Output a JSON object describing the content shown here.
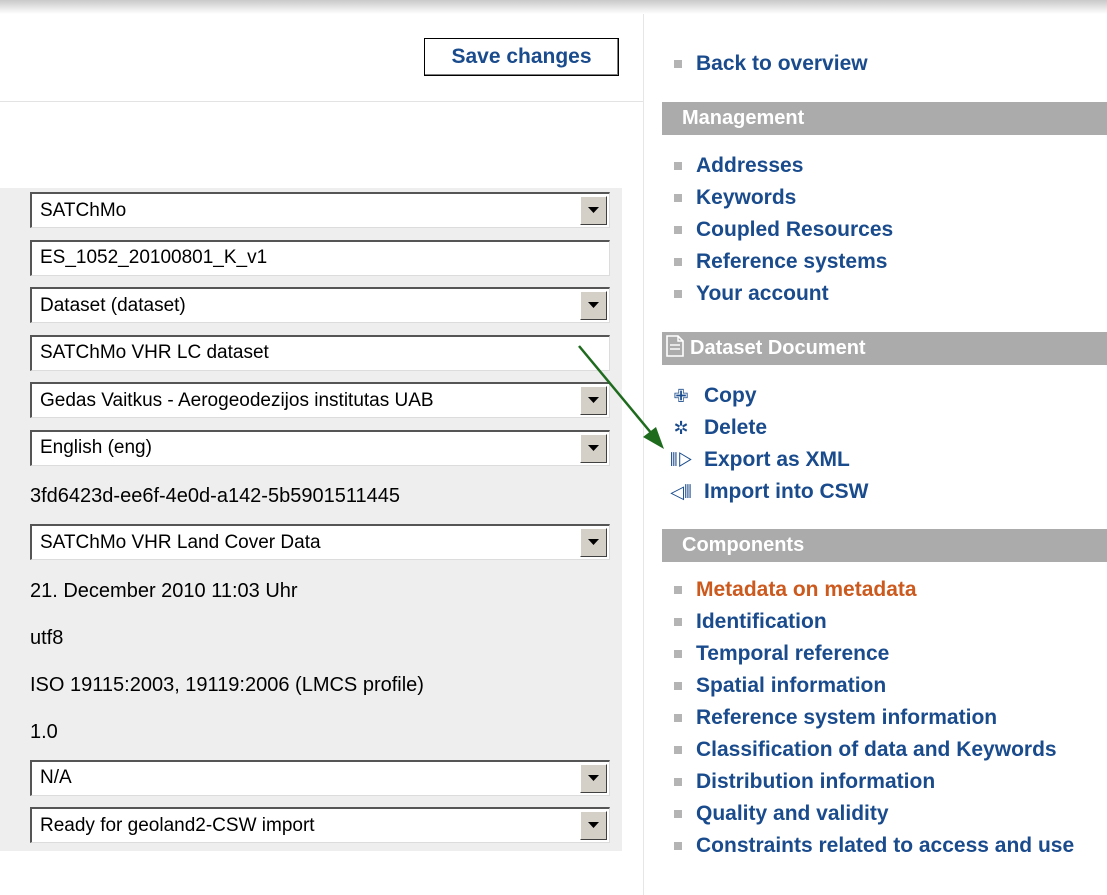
{
  "toolbar": {
    "save_label": "Save changes"
  },
  "form": {
    "fields": [
      {
        "kind": "select",
        "value": "SATChMo"
      },
      {
        "kind": "input",
        "value": "ES_1052_20100801_K_v1"
      },
      {
        "kind": "select",
        "value": "Dataset (dataset)"
      },
      {
        "kind": "input",
        "value": "SATChMo VHR LC dataset"
      },
      {
        "kind": "select",
        "value": "Gedas Vaitkus - Aerogeodezijos institutas UAB"
      },
      {
        "kind": "select",
        "value": "English (eng)"
      },
      {
        "kind": "text",
        "value": "3fd6423d-ee6f-4e0d-a142-5b5901511445"
      },
      {
        "kind": "select",
        "value": "SATChMo VHR Land Cover Data"
      },
      {
        "kind": "text",
        "value": "21. December 2010 11:03 Uhr"
      },
      {
        "kind": "text",
        "value": "utf8"
      },
      {
        "kind": "text",
        "value": "ISO 19115:2003, 19119:2006 (LMCS profile)"
      },
      {
        "kind": "text",
        "value": "1.0"
      },
      {
        "kind": "select",
        "value": "N/A"
      },
      {
        "kind": "select",
        "value": "Ready for geoland2-CSW import"
      }
    ]
  },
  "nav": {
    "back_label": "Back to overview",
    "management": {
      "title": "Management",
      "items": [
        "Addresses",
        "Keywords",
        "Coupled Resources",
        "Reference systems",
        "Your account"
      ]
    },
    "document": {
      "title": "Dataset Document",
      "items": [
        {
          "icon": "copy-icon",
          "label": "Copy"
        },
        {
          "icon": "delete-icon",
          "label": "Delete"
        },
        {
          "icon": "export-icon",
          "label": "Export as XML"
        },
        {
          "icon": "import-icon",
          "label": "Import into CSW"
        }
      ]
    },
    "components": {
      "title": "Components",
      "items": [
        "Metadata on metadata",
        "Identification",
        "Temporal reference",
        "Spatial information",
        "Reference system information",
        "Classification of data and Keywords",
        "Distribution information",
        "Quality and validity",
        "Constraints related to access and use"
      ],
      "active_index": 0
    }
  },
  "colors": {
    "link": "#1a4b8c",
    "active_link": "#cc5a1e",
    "section_header": "#ababab",
    "row_background": "#eeeeee",
    "annotation_arrow": "#1e6b1e"
  }
}
